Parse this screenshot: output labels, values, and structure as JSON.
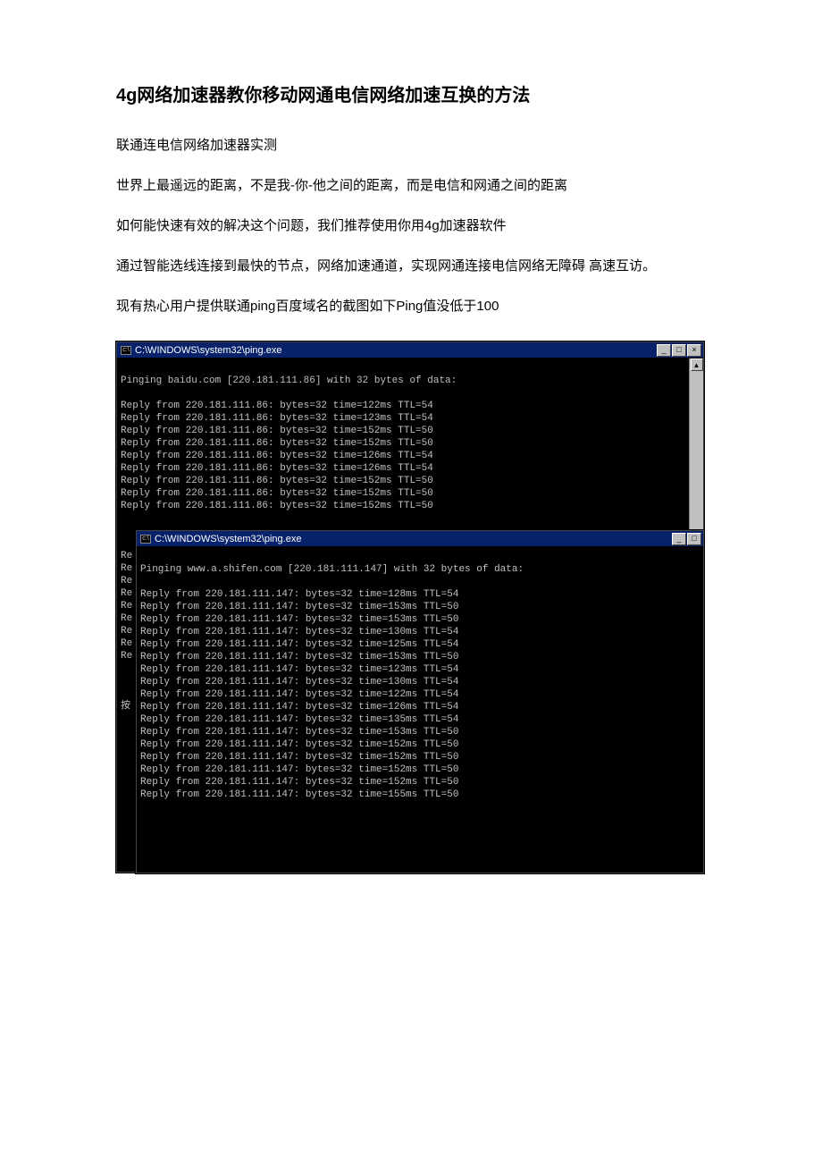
{
  "article": {
    "title": "4g网络加速器教你移动网通电信网络加速互换的方法",
    "p1": "联通连电信网络加速器实测",
    "p2": "世界上最遥远的距离，不是我-你-他之间的距离，而是电信和网通之间的距离",
    "p3": "如何能快速有效的解决这个问题，我们推荐使用你用4g加速器软件",
    "p4": "通过智能选线连接到最快的节点，网络加速通道，实现网通连接电信网络无障碍 高速互访。",
    "p5": "现有热心用户提供联通ping百度域名的截图如下Ping值没低于100"
  },
  "term1": {
    "title_prefix": "C:\\WINDOWS\\system32\\ping.exe",
    "icon_glyph": "c:\\",
    "header_blank": "",
    "pinging": "Pinging baidu.com [220.181.111.86] with 32 bytes of data:",
    "replies": [
      "Reply from 220.181.111.86: bytes=32 time=122ms TTL=54",
      "Reply from 220.181.111.86: bytes=32 time=123ms TTL=54",
      "Reply from 220.181.111.86: bytes=32 time=152ms TTL=50",
      "Reply from 220.181.111.86: bytes=32 time=152ms TTL=50",
      "Reply from 220.181.111.86: bytes=32 time=126ms TTL=54",
      "Reply from 220.181.111.86: bytes=32 time=126ms TTL=54",
      "Reply from 220.181.111.86: bytes=32 time=152ms TTL=50",
      "Reply from 220.181.111.86: bytes=32 time=152ms TTL=50",
      "Reply from 220.181.111.86: bytes=32 time=152ms TTL=50"
    ],
    "peek": "Re\nRe\nRe\nRe\nRe\nRe\nRe\nRe\nRe\n\n\n\n按"
  },
  "term2": {
    "title_prefix": "C:\\WINDOWS\\system32\\ping.exe",
    "icon_glyph": "c:\\",
    "pinging": "Pinging www.a.shifen.com [220.181.111.147] with 32 bytes of data:",
    "replies": [
      "Reply from 220.181.111.147: bytes=32 time=128ms TTL=54",
      "Reply from 220.181.111.147: bytes=32 time=153ms TTL=50",
      "Reply from 220.181.111.147: bytes=32 time=153ms TTL=50",
      "Reply from 220.181.111.147: bytes=32 time=130ms TTL=54",
      "Reply from 220.181.111.147: bytes=32 time=125ms TTL=54",
      "Reply from 220.181.111.147: bytes=32 time=153ms TTL=50",
      "Reply from 220.181.111.147: bytes=32 time=123ms TTL=54",
      "Reply from 220.181.111.147: bytes=32 time=130ms TTL=54",
      "Reply from 220.181.111.147: bytes=32 time=122ms TTL=54",
      "Reply from 220.181.111.147: bytes=32 time=126ms TTL=54",
      "Reply from 220.181.111.147: bytes=32 time=135ms TTL=54",
      "Reply from 220.181.111.147: bytes=32 time=153ms TTL=50",
      "Reply from 220.181.111.147: bytes=32 time=152ms TTL=50",
      "Reply from 220.181.111.147: bytes=32 time=152ms TTL=50",
      "Reply from 220.181.111.147: bytes=32 time=152ms TTL=50",
      "Reply from 220.181.111.147: bytes=32 time=152ms TTL=50",
      "Reply from 220.181.111.147: bytes=32 time=155ms TTL=50"
    ]
  },
  "win_buttons": {
    "minimize": "_",
    "maximize": "□",
    "close": "×"
  }
}
